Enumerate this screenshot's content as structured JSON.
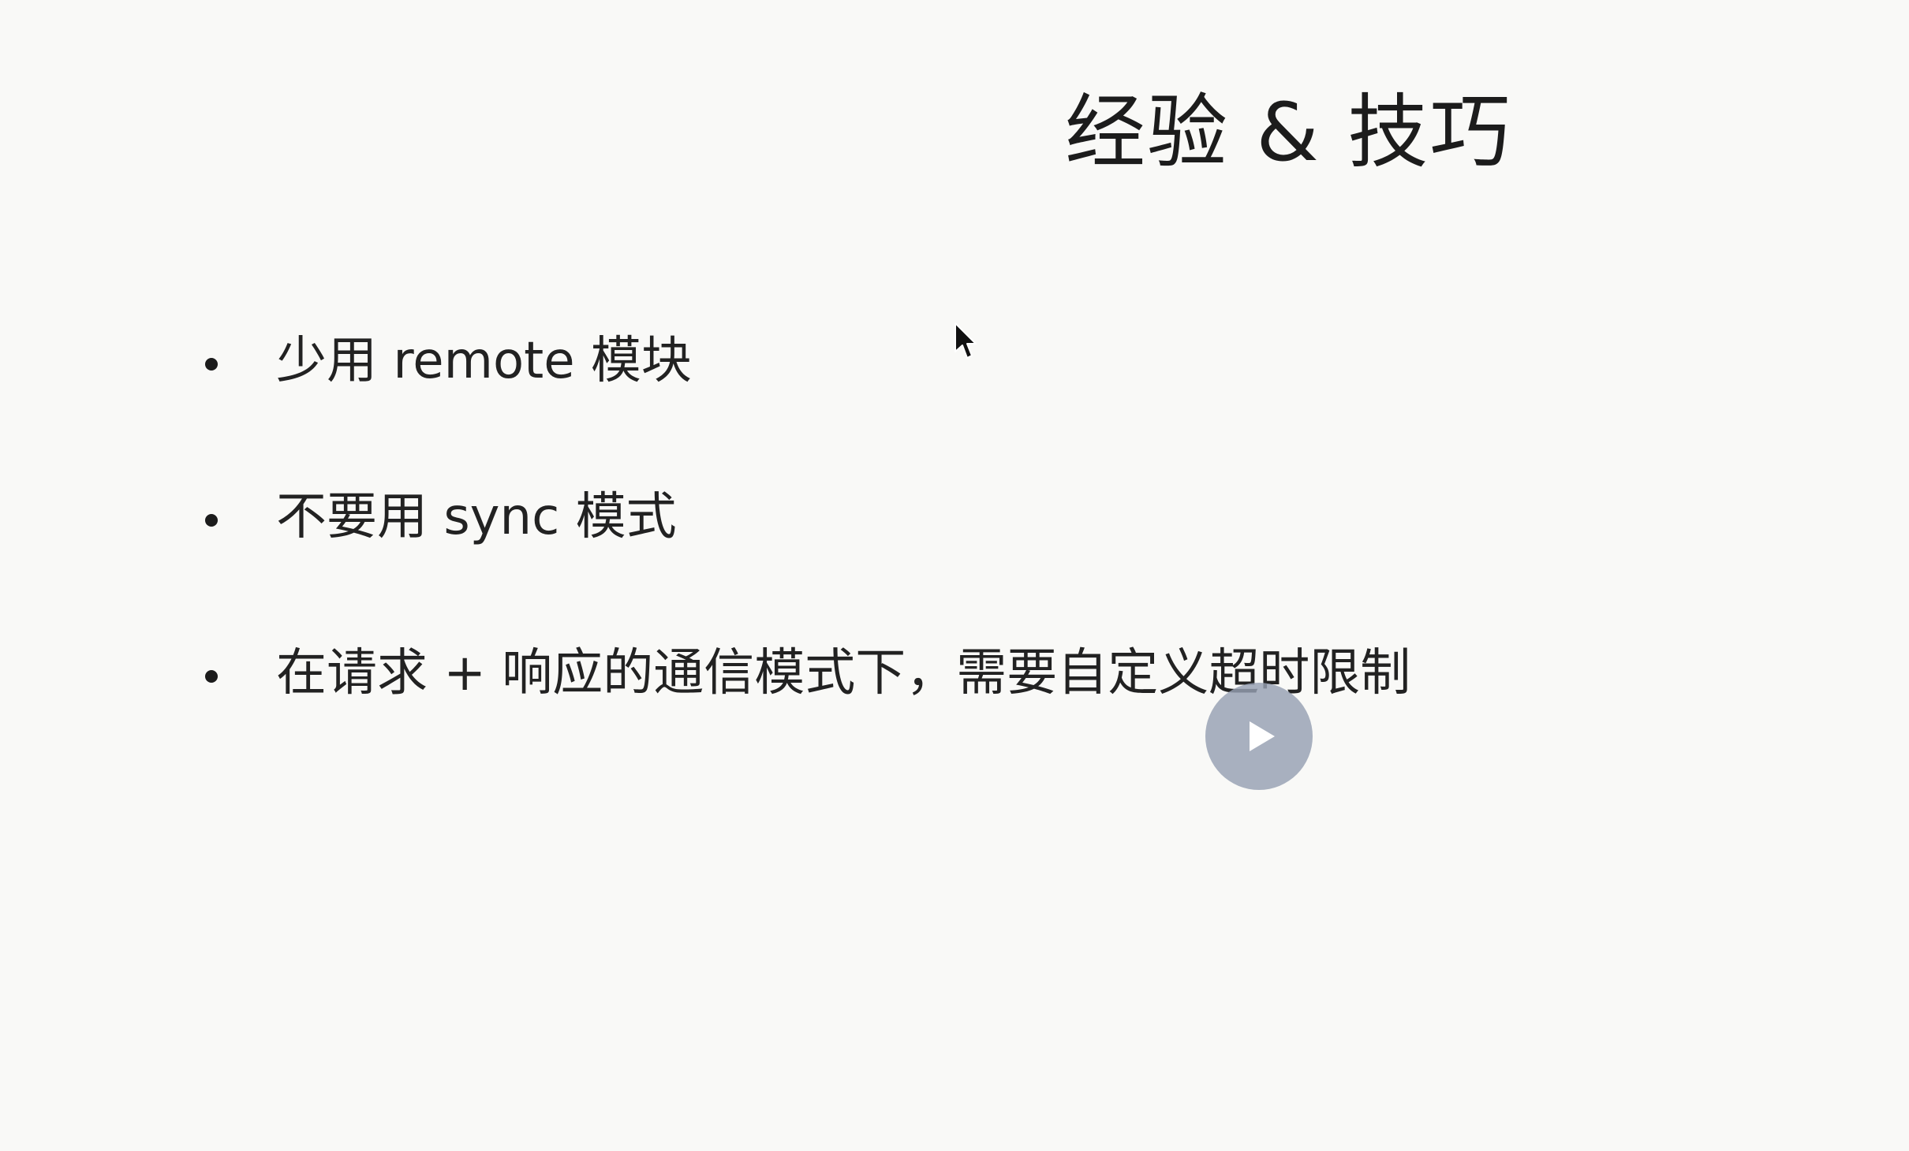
{
  "slide": {
    "title": "经验 & 技巧",
    "bullets": [
      {
        "text": "少用 remote 模块"
      },
      {
        "text": "不要用 sync 模式"
      },
      {
        "text": "在请求 + 响应的通信模式下，需要自定义超时限制"
      }
    ]
  },
  "icons": {
    "cursor": "mouse-pointer-icon",
    "play": "play-icon"
  },
  "colors": {
    "background": "#f9f9f7",
    "text": "#222222",
    "play_button": "#96a0b2"
  }
}
